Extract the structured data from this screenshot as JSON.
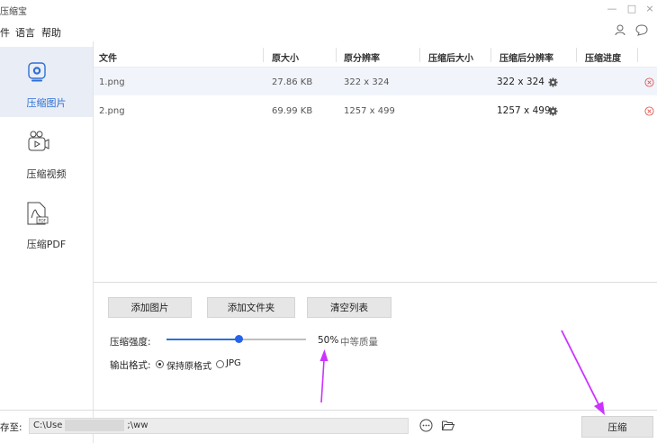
{
  "app": {
    "title": "压缩宝"
  },
  "window_controls": {
    "minimize": "—",
    "maximize": "□",
    "close": "×"
  },
  "menu": {
    "items": [
      "件",
      "语言",
      "帮助"
    ]
  },
  "sidebar": {
    "items": [
      {
        "label": "压缩图片",
        "icon": "image-compress-icon",
        "active": true
      },
      {
        "label": "压缩视频",
        "icon": "video-compress-icon",
        "active": false
      },
      {
        "label": "压缩PDF",
        "icon": "pdf-compress-icon",
        "active": false
      }
    ]
  },
  "table": {
    "headers": [
      "文件",
      "原大小",
      "原分辨率",
      "压缩后大小",
      "压缩后分辨率",
      "压缩进度"
    ],
    "rows": [
      {
        "file": "1.png",
        "size": "27.86 KB",
        "resolution": "322 x 324",
        "compressed_size": "",
        "compressed_resolution": "322 x 324",
        "progress": ""
      },
      {
        "file": "2.png",
        "size": "69.99 KB",
        "resolution": "1257 x 499",
        "compressed_size": "",
        "compressed_resolution": "1257 x 499",
        "progress": ""
      }
    ]
  },
  "actions": {
    "add_image": "添加图片",
    "add_folder": "添加文件夹",
    "clear_list": "清空列表"
  },
  "settings": {
    "strength_label": "压缩强度:",
    "strength_value": "50%",
    "strength_fraction": 0.5,
    "quality_label": "中等质量",
    "format_label": "输出格式:",
    "format_options": [
      "保持原格式",
      "JPG"
    ],
    "format_selected": "保持原格式"
  },
  "save": {
    "label": "存至:",
    "path_prefix": "C:\\Use",
    "path_suffix": ";\\ww",
    "compress_button": "压缩"
  },
  "colors": {
    "accent": "#2563eb",
    "annotation_arrow": "#cc33ff",
    "remove": "#e05a5a",
    "active_bg": "#e9eef6"
  }
}
